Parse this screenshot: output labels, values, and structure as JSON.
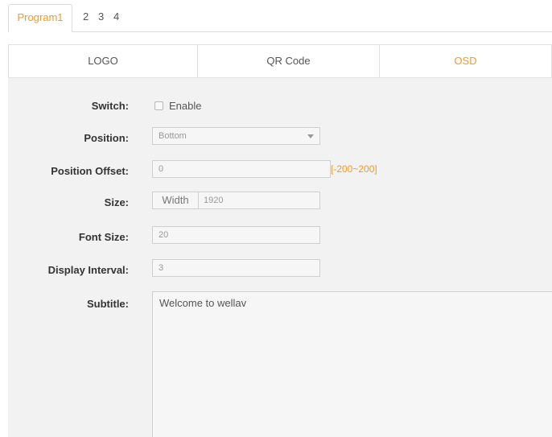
{
  "program_tabs": [
    {
      "label": "Program1",
      "active": true
    },
    {
      "label": "2",
      "active": false
    },
    {
      "label": "3",
      "active": false
    },
    {
      "label": "4",
      "active": false
    }
  ],
  "sub_tabs": [
    {
      "label": "LOGO",
      "active": false
    },
    {
      "label": "QR Code",
      "active": false
    },
    {
      "label": "OSD",
      "active": true
    }
  ],
  "form": {
    "switch": {
      "label": "Switch:",
      "checkbox_label": "Enable",
      "checked": false
    },
    "position": {
      "label": "Position:",
      "value": "Bottom"
    },
    "position_offset": {
      "label": "Position Offset:",
      "value": "0",
      "range": "[-200~200]"
    },
    "size": {
      "label": "Size:",
      "addon": "Width",
      "value": "1920"
    },
    "font_size": {
      "label": "Font Size:",
      "value": "20"
    },
    "display_interval": {
      "label": "Display Interval:",
      "value": "3"
    },
    "subtitle": {
      "label": "Subtitle:",
      "value": "Welcome to wellav"
    }
  },
  "colors": {
    "accent": "#f59a23",
    "panel_bg": "#f2f2f2",
    "border": "#cfcfcf"
  }
}
